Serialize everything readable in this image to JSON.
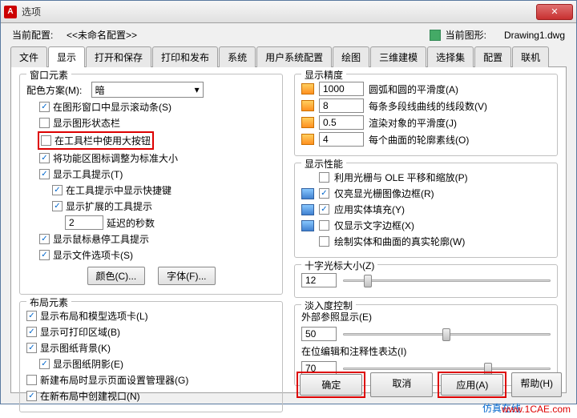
{
  "title": "选项",
  "current_profile_label": "当前配置:",
  "current_profile_value": "<<未命名配置>>",
  "current_drawing_label": "当前图形:",
  "current_drawing_value": "Drawing1.dwg",
  "tabs": [
    "文件",
    "显示",
    "打开和保存",
    "打印和发布",
    "系统",
    "用户系统配置",
    "绘图",
    "三维建模",
    "选择集",
    "配置",
    "联机"
  ],
  "active_tab": 1,
  "window_elements": {
    "title": "窗口元素",
    "scheme_label": "配色方案(M):",
    "scheme_value": "暗",
    "c1": "在图形窗口中显示滚动条(S)",
    "c2": "显示图形状态栏",
    "c3": "在工具栏中使用大按钮",
    "c4": "将功能区图标调整为标准大小",
    "c5": "显示工具提示(T)",
    "c6": "在工具提示中显示快捷键",
    "c7": "显示扩展的工具提示",
    "delay_label": "延迟的秒数",
    "delay_value": "2",
    "c8": "显示鼠标悬停工具提示",
    "c9": "显示文件选项卡(S)",
    "color_btn": "颜色(C)...",
    "font_btn": "字体(F)..."
  },
  "layout_elements": {
    "title": "布局元素",
    "c1": "显示布局和模型选项卡(L)",
    "c2": "显示可打印区域(B)",
    "c3": "显示图纸背景(K)",
    "c4": "显示图纸阴影(E)",
    "c5": "新建布局时显示页面设置管理器(G)",
    "c6": "在新布局中创建视口(N)"
  },
  "display_precision": {
    "title": "显示精度",
    "r1_val": "1000",
    "r1_label": "圆弧和圆的平滑度(A)",
    "r2_val": "8",
    "r2_label": "每条多段线曲线的线段数(V)",
    "r3_val": "0.5",
    "r3_label": "渲染对象的平滑度(J)",
    "r4_val": "4",
    "r4_label": "每个曲面的轮廓素线(O)"
  },
  "display_perf": {
    "title": "显示性能",
    "c1": "利用光栅与 OLE 平移和缩放(P)",
    "c2": "仅亮显光栅图像边框(R)",
    "c3": "应用实体填充(Y)",
    "c4": "仅显示文字边框(X)",
    "c5": "绘制实体和曲面的真实轮廓(W)"
  },
  "crosshair": {
    "title": "十字光标大小(Z)",
    "value": "12"
  },
  "fade": {
    "title": "淡入度控制",
    "xref_label": "外部参照显示(E)",
    "xref_value": "50",
    "edit_label": "在位编辑和注释性表达(I)",
    "edit_value": "70"
  },
  "buttons": {
    "ok": "确定",
    "cancel": "取消",
    "apply": "应用(A)",
    "help": "帮助(H)"
  },
  "watermark1": "仿真在线",
  "watermark2": "www.1CAE.com"
}
